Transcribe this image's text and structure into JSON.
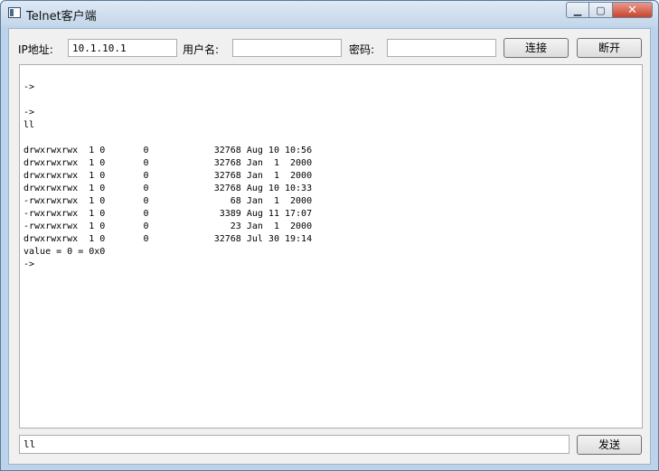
{
  "window": {
    "title": "Telnet客户端",
    "buttons": {
      "minimize": "▁",
      "maximize": "▢",
      "close": "✕"
    }
  },
  "connection": {
    "ip_label": "IP地址:",
    "ip_value": "10.1.10.1",
    "user_label": "用户名:",
    "user_value": "",
    "password_label": "密码:",
    "password_value": "",
    "connect_label": "连接",
    "disconnect_label": "断开"
  },
  "console": {
    "lines": [
      "",
      "->",
      "",
      "->",
      "ll",
      "",
      "drwxrwxrwx  1 0       0            32768 Aug 10 10:56 ",
      "drwxrwxrwx  1 0       0            32768 Jan  1  2000 ",
      "drwxrwxrwx  1 0       0            32768 Jan  1  2000 ",
      "drwxrwxrwx  1 0       0            32768 Aug 10 10:33 ",
      "-rwxrwxrwx  1 0       0               68 Jan  1  2000 ",
      "-rwxrwxrwx  1 0       0             3389 Aug 11 17:07 ",
      "-rwxrwxrwx  1 0       0               23 Jan  1  2000 ",
      "drwxrwxrwx  1 0       0            32768 Jul 30 19:14 ",
      "value = 0 = 0x0",
      "->"
    ]
  },
  "send": {
    "input_value": "ll",
    "button_label": "发送"
  }
}
